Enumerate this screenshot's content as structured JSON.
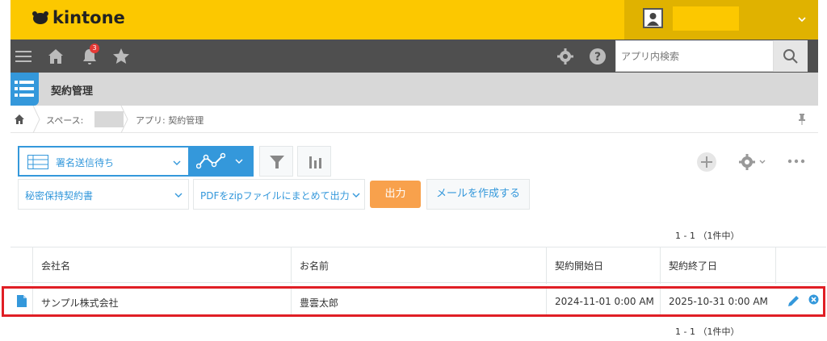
{
  "header": {
    "logo_text": "kintone",
    "user_caret_icon": "chevron-down-icon"
  },
  "nav": {
    "notification_count": "3",
    "search_placeholder": "アプリ内検索"
  },
  "app": {
    "title": "契約管理"
  },
  "breadcrumb": {
    "space_label": "スペース:",
    "app_label": "アプリ: 契約管理"
  },
  "toolbar": {
    "view_name": "署名送信待ち",
    "filter_select": "秘密保持契約書",
    "output_select": "PDFをzipファイルにまとめて出力",
    "output_button": "出力",
    "mail_button": "メールを作成する"
  },
  "pager": {
    "text": "1 - 1 （1件中）"
  },
  "table": {
    "columns": [
      "会社名",
      "お名前",
      "契約開始日",
      "契約終了日"
    ],
    "rows": [
      {
        "company": "サンプル株式会社",
        "name": "豊雲太郎",
        "start": "2024-11-01 0:00 AM",
        "end": "2025-10-31 0:00 AM"
      }
    ]
  },
  "colors": {
    "header_yellow": "#fcc800",
    "nav_gray": "#4f4f4f",
    "accent_blue": "#3498db",
    "output_orange": "#f8a14c",
    "highlight_red": "#e01e25"
  }
}
